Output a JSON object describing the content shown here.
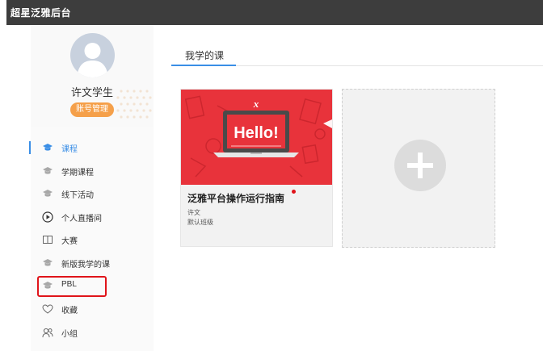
{
  "app": {
    "title": "超星泛雅后台"
  },
  "user": {
    "name": "许文学生",
    "account_button": "账号管理"
  },
  "sidebar": {
    "items": [
      {
        "label": "课程",
        "icon": "graduation-cap-icon",
        "active": true
      },
      {
        "label": "学期课程",
        "icon": "graduation-cap-icon",
        "active": false
      },
      {
        "label": "线下活动",
        "icon": "graduation-cap-icon",
        "active": false
      },
      {
        "label": "个人直播间",
        "icon": "play-circle-icon",
        "active": false
      },
      {
        "label": "大赛",
        "icon": "book-icon",
        "active": false
      },
      {
        "label": "新版我学的课",
        "icon": "graduation-cap-icon",
        "active": false
      },
      {
        "label": "PBL",
        "icon": "graduation-cap-icon",
        "active": false,
        "highlighted": true
      },
      {
        "label": "收藏",
        "icon": "heart-icon",
        "active": false
      },
      {
        "label": "小组",
        "icon": "group-icon",
        "active": false
      }
    ]
  },
  "main": {
    "tab": "我学的课",
    "course": {
      "cover_text": "Hello!",
      "cover_logo": "x",
      "title": "泛雅平台操作运行指南",
      "teacher": "许文",
      "class_name": "默认班级"
    }
  },
  "colors": {
    "accent": "#3a8ee6",
    "cover": "#e8333b",
    "orange": "#f5a04a",
    "highlight": "#e0141a"
  }
}
